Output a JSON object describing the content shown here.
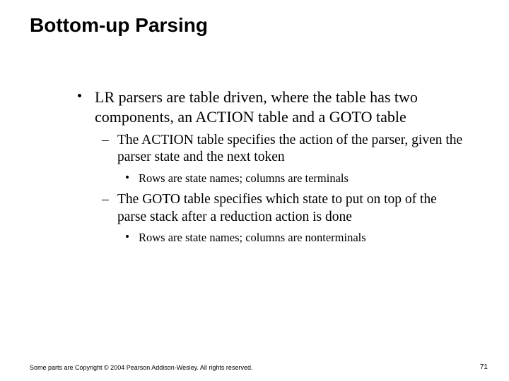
{
  "slide": {
    "title": "Bottom-up Parsing",
    "bullets": {
      "l1": "LR parsers are table driven, where the table has two components, an ACTION table and a GOTO table",
      "l2a": "The ACTION table specifies the action of the parser, given the parser state and the next token",
      "l3a": "Rows are state names; columns are terminals",
      "l2b": "The GOTO table specifies which state to put on top of the parse stack after a reduction action is done",
      "l3b": "Rows are state names; columns are nonterminals"
    },
    "footer": {
      "copyright": "Some parts are Copyright © 2004 Pearson Addison-Wesley. All rights reserved.",
      "page": "71"
    }
  }
}
